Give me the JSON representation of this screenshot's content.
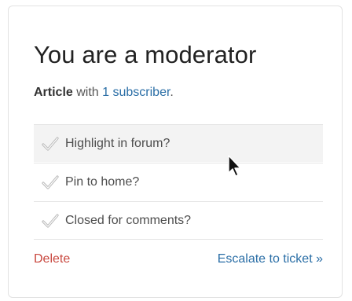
{
  "panel": {
    "title": "You are a moderator",
    "subtitle": {
      "type": "Article",
      "middle": " with ",
      "subscribers_link": "1 subscriber",
      "end": "."
    },
    "options": [
      {
        "label": "Highlight in forum?",
        "icon": "check-icon",
        "hovered": true
      },
      {
        "label": "Pin to home?",
        "icon": "check-icon",
        "hovered": false
      },
      {
        "label": "Closed for comments?",
        "icon": "check-icon",
        "hovered": false
      }
    ],
    "actions": {
      "delete_label": "Delete",
      "escalate_label": "Escalate to ticket »"
    }
  },
  "colors": {
    "link": "#2a6ea6",
    "danger": "#c9483f",
    "hover_row": "#f3f3f3"
  }
}
